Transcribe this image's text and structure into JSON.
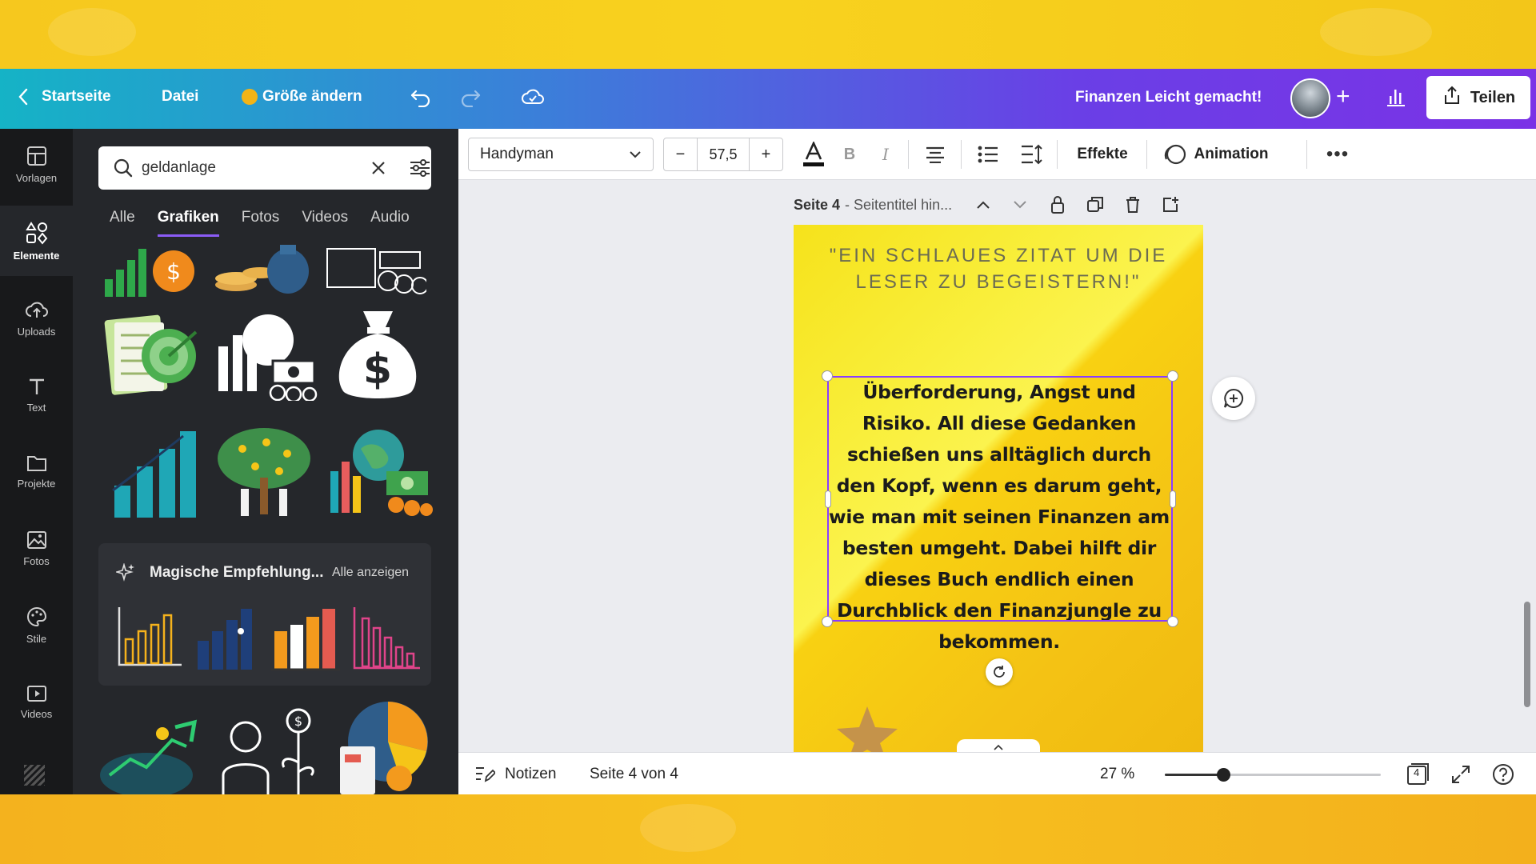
{
  "topbar": {
    "home_label": "Startseite",
    "file_label": "Datei",
    "resize_label": "Größe ändern",
    "project_title": "Finanzen Leicht gemacht!",
    "share_label": "Teilen"
  },
  "rail": {
    "items": [
      {
        "label": "Vorlagen",
        "icon": "templates-icon"
      },
      {
        "label": "Elemente",
        "icon": "elements-icon",
        "active": true
      },
      {
        "label": "Uploads",
        "icon": "upload-icon"
      },
      {
        "label": "Text",
        "icon": "text-icon"
      },
      {
        "label": "Projekte",
        "icon": "folder-icon"
      },
      {
        "label": "Fotos",
        "icon": "photo-icon"
      },
      {
        "label": "Stile",
        "icon": "palette-icon"
      },
      {
        "label": "Videos",
        "icon": "video-icon"
      }
    ]
  },
  "panel": {
    "search_value": "geldanlage",
    "tabs": [
      "Alle",
      "Grafiken",
      "Fotos",
      "Videos",
      "Audio"
    ],
    "active_tab": "Grafiken",
    "magic_title": "Magische Empfehlung...",
    "magic_see_all": "Alle anzeigen"
  },
  "toolbar": {
    "font": "Handyman",
    "font_size": "57,5",
    "effects_label": "Effekte",
    "animation_label": "Animation"
  },
  "page": {
    "header_number": "Seite 4",
    "header_title": "- Seitentitel hin...",
    "quote": "\"EIN SCHLAUES ZITAT UM DIE LESER ZU BEGEISTERN!\"",
    "body": "Überforderung, Angst und Risiko. All diese Gedanken schießen uns alltäglich durch den Kopf, wenn es darum geht, wie man mit seinen Finanzen am besten umgeht. Dabei hilft dir dieses Buch endlich einen Durchblick den Finanzjungle zu bekommen."
  },
  "bottombar": {
    "notes_label": "Notizen",
    "page_indicator": "Seite 4 von 4",
    "zoom_label": "27 %",
    "zoom_fraction": 0.27,
    "page_count": "4"
  },
  "colors": {
    "accent": "#8b3dff",
    "rail_bg": "#18191b",
    "panel_bg": "#25272b"
  }
}
